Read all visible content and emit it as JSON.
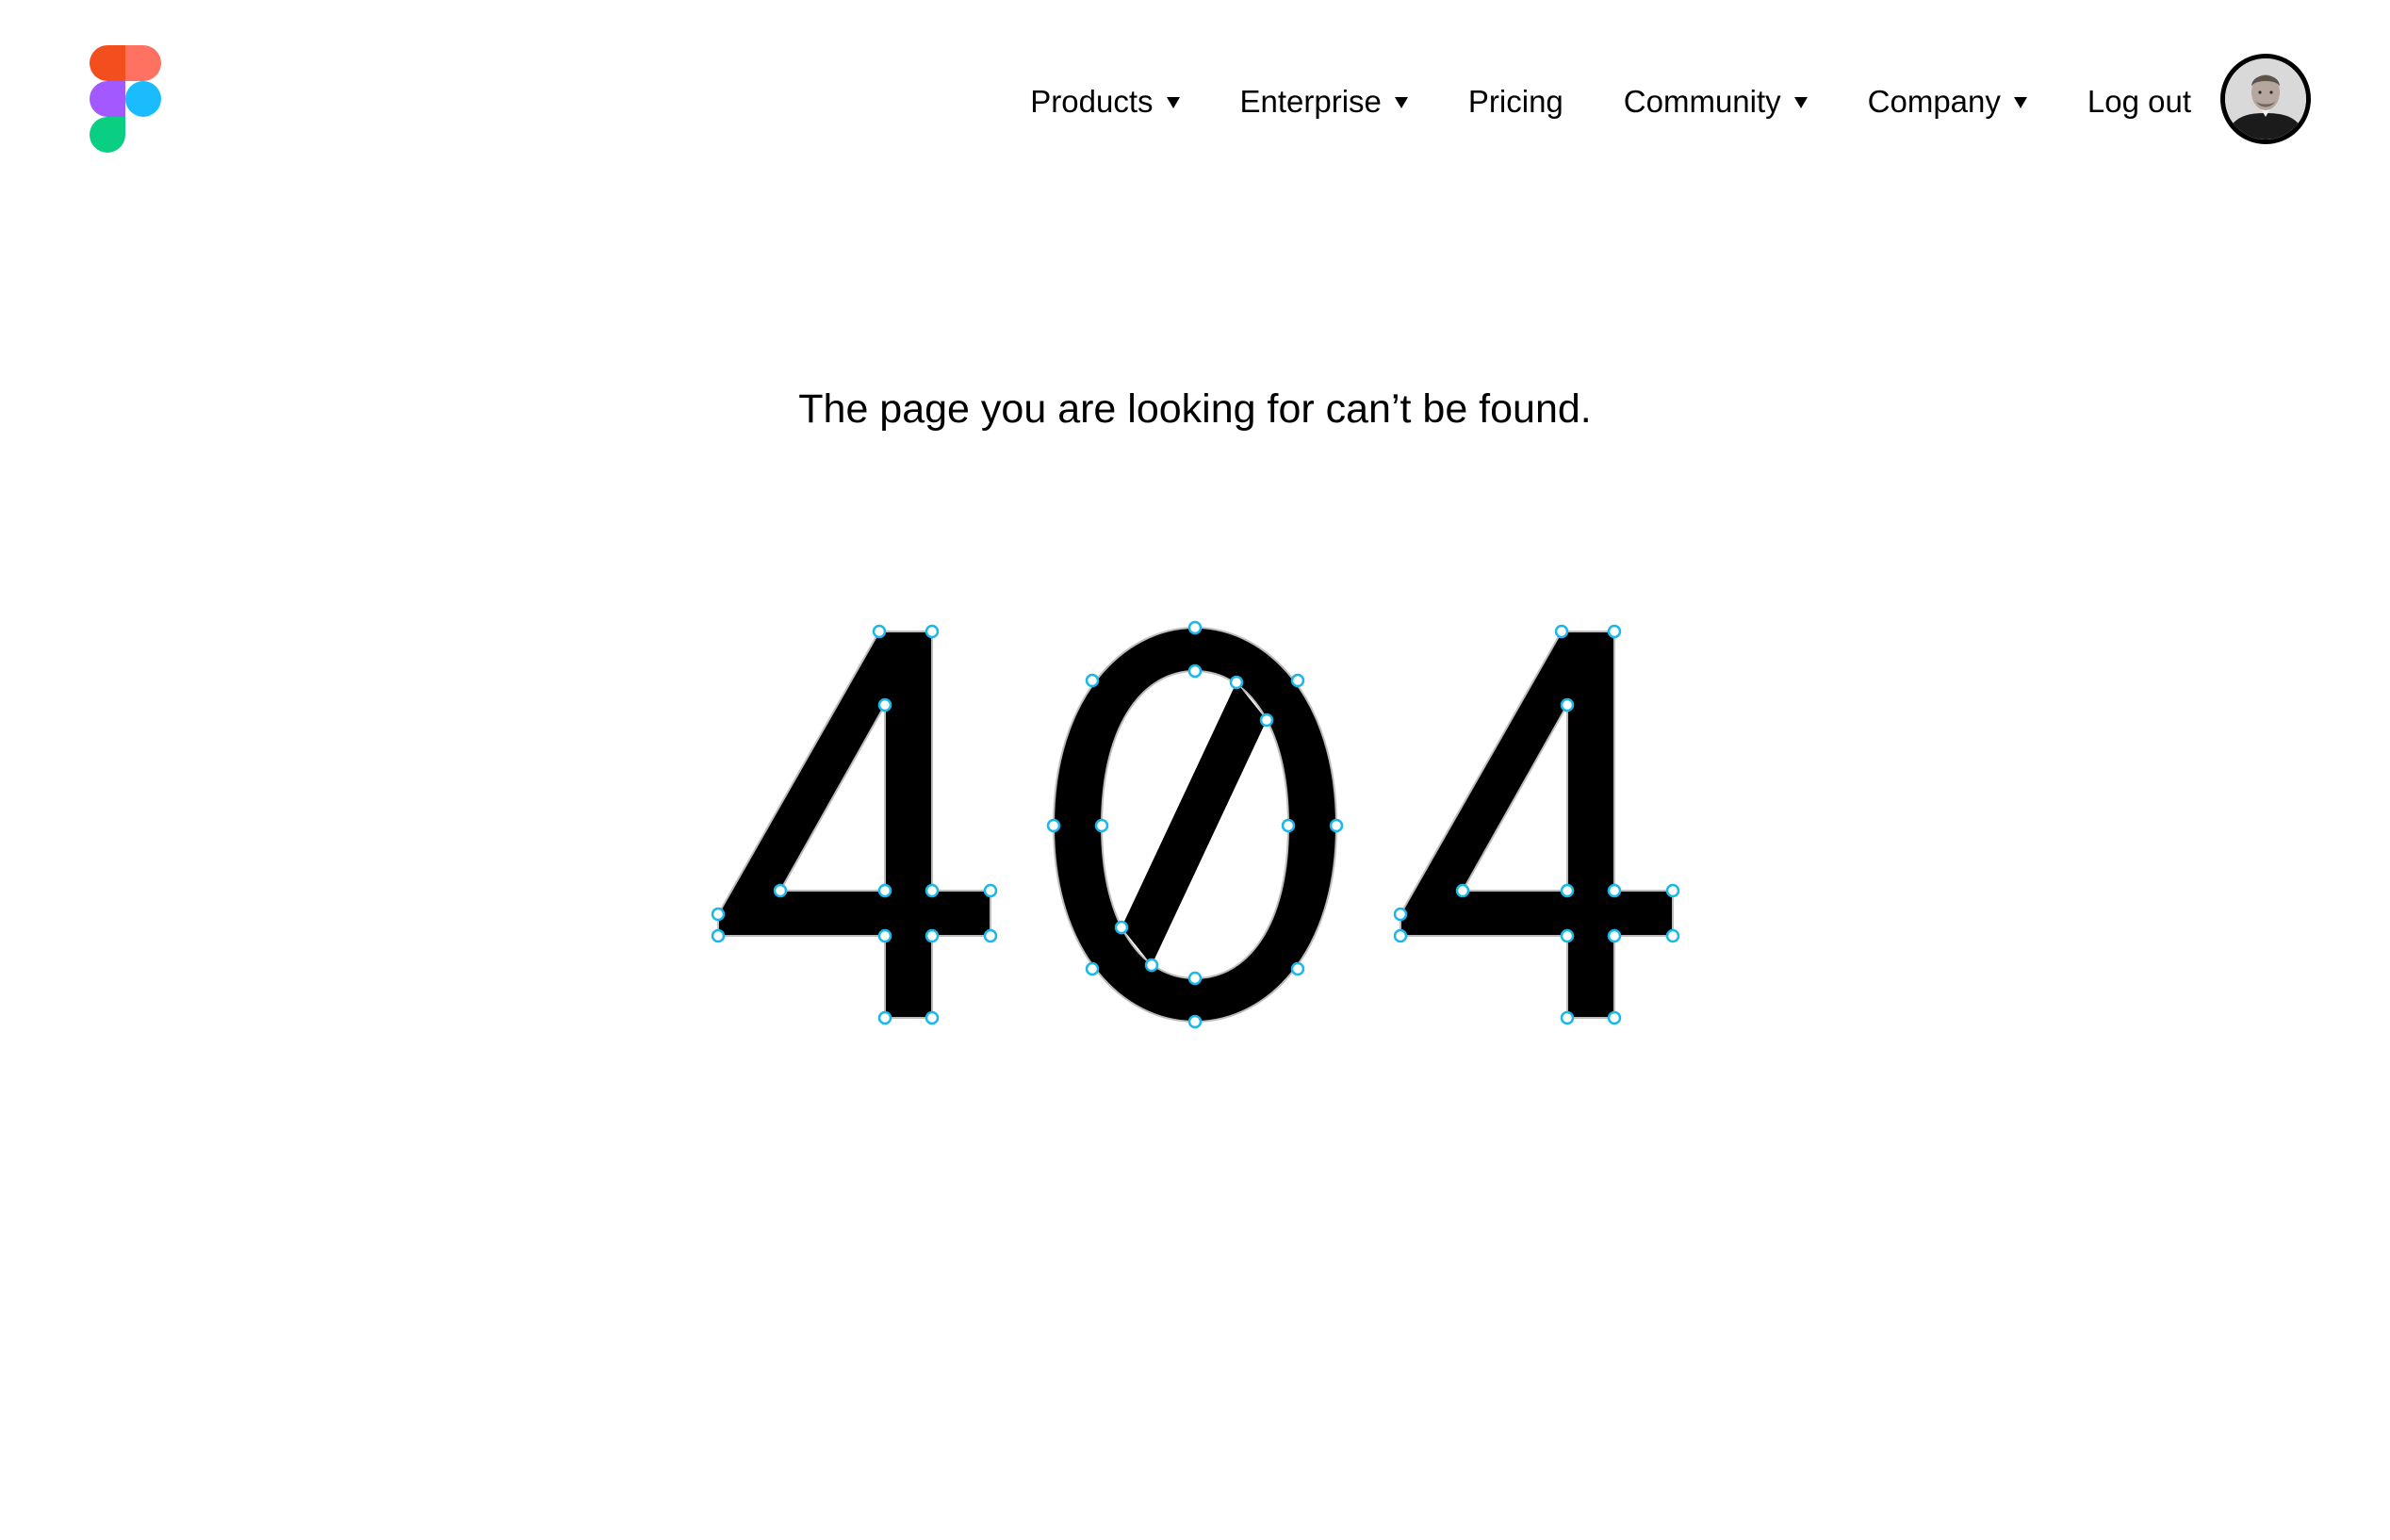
{
  "brand": {
    "logo_icon": "figma-logo-icon",
    "colors": [
      "#F24E1E",
      "#FF7262",
      "#A259FF",
      "#1ABCFE",
      "#0ACF83"
    ]
  },
  "nav": {
    "items": [
      {
        "label": "Products",
        "has_dropdown": true,
        "icon": "caret-down-icon"
      },
      {
        "label": "Enterprise",
        "has_dropdown": true,
        "icon": "caret-down-icon"
      },
      {
        "label": "Pricing",
        "has_dropdown": false
      },
      {
        "label": "Community",
        "has_dropdown": true,
        "icon": "caret-down-icon"
      },
      {
        "label": "Company",
        "has_dropdown": true,
        "icon": "caret-down-icon"
      },
      {
        "label": "Log out",
        "has_dropdown": false
      }
    ],
    "avatar_icon": "user-avatar"
  },
  "main": {
    "message": "The page you are looking for can’t be found.",
    "error_code": "404",
    "glyph_color": "#000000",
    "vector_point_color": "#1AB7EA"
  }
}
